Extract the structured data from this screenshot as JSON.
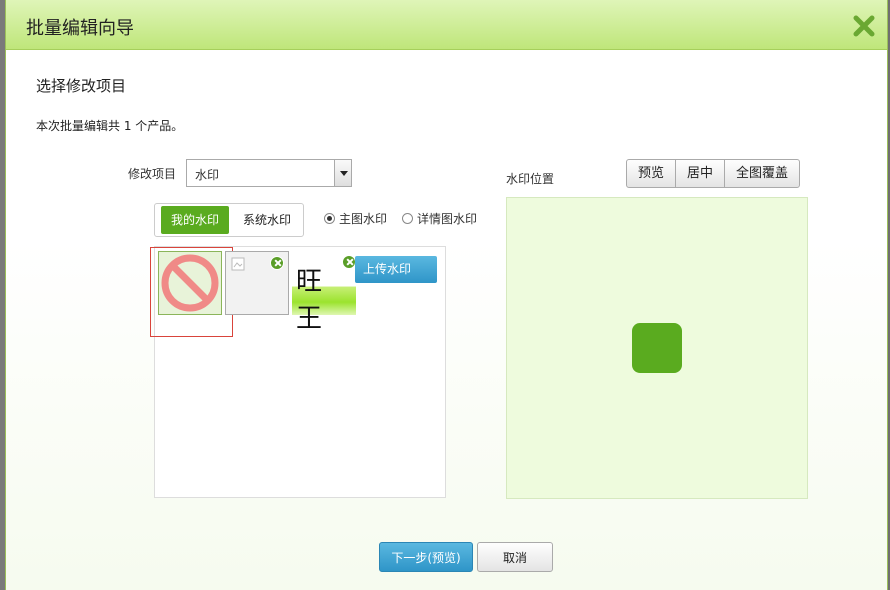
{
  "dialog": {
    "title": "批量编辑向导",
    "close_icon": "close-icon"
  },
  "section": {
    "title": "选择修改项目",
    "info": "本次批量编辑共 1 个产品。"
  },
  "modify_item": {
    "label": "修改项目",
    "selected": "水印"
  },
  "watermark_tabs": [
    {
      "label": "我的水印",
      "active": true
    },
    {
      "label": "系统水印",
      "active": false
    }
  ],
  "watermark_type": [
    {
      "label": "主图水印",
      "checked": true
    },
    {
      "label": "详情图水印",
      "checked": false
    }
  ],
  "watermarks": {
    "items": [
      {
        "icon": "no-entry-icon",
        "selected": true
      },
      {
        "icon": "broken-image-icon",
        "selected": false
      },
      {
        "text": "旺 王",
        "selected": false
      }
    ],
    "upload_label": "上传水印"
  },
  "position": {
    "label": "水印位置",
    "buttons": [
      "预览",
      "居中",
      "全图覆盖"
    ],
    "accent": "#5aab1f"
  },
  "footer": {
    "next_label": "下一步(预览)",
    "cancel_label": "取消"
  }
}
